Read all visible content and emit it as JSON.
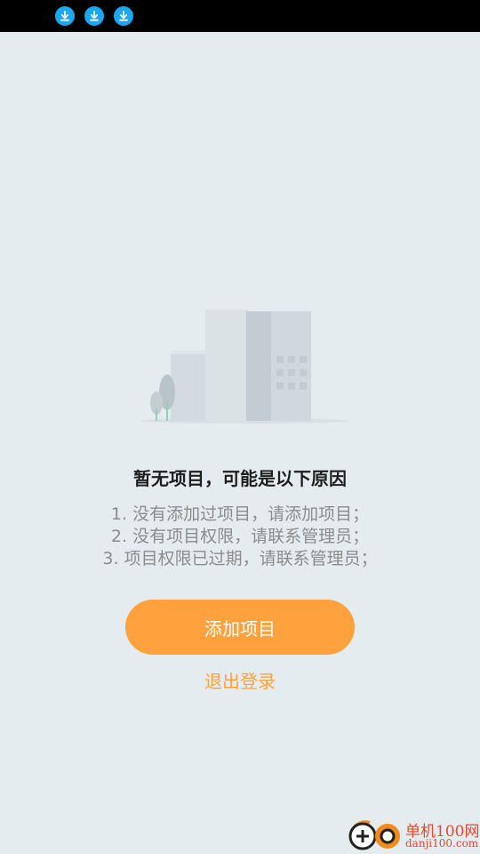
{
  "status_bar": {
    "icons": [
      "download-icon",
      "download-icon",
      "download-icon"
    ],
    "icon_color": "#1aa9f0"
  },
  "empty_state": {
    "illustration": "empty-building-illustration",
    "title": "暂无项目，可能是以下原因",
    "reasons": [
      "1. 没有添加过项目，请添加项目；",
      "2. 没有项目权限，请联系管理员；",
      "3. 项目权限已过期，请联系管理员；"
    ]
  },
  "actions": {
    "add_project_label": "添加项目",
    "logout_label": "退出登录",
    "accent_color": "#ffa23d"
  },
  "watermark": {
    "brand": "单机100网",
    "url": "danji100.com"
  }
}
